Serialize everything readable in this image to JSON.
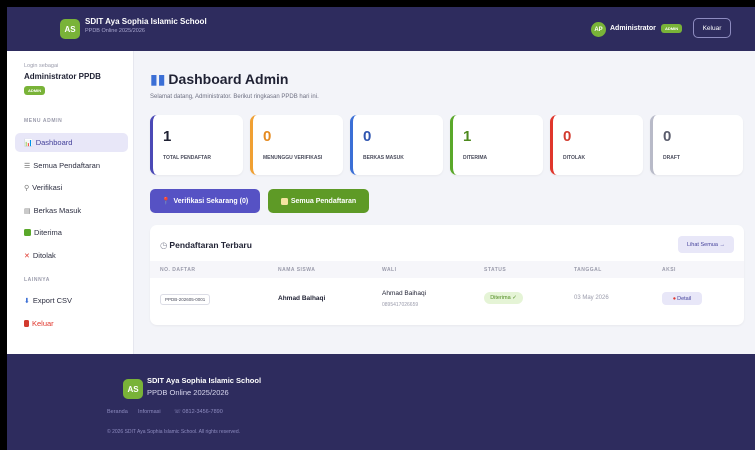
{
  "header": {
    "logo_initials": "AS",
    "school_name": "SDIT Aya Sophia Islamic School",
    "subtitle": "PPDB Online 2025/2026",
    "avatar_initials": "AP",
    "user_name": "Administrator",
    "role_badge": "ADMIN",
    "logout_label": "Keluar"
  },
  "sidebar": {
    "login_as": "Login sebagai",
    "user_name": "Administrator PPDB",
    "role_badge": "ADMIN",
    "menu_section": "MENU ADMIN",
    "items": [
      {
        "label": "Dashboard",
        "icon": "chart-icon"
      },
      {
        "label": "Semua Pendaftaran",
        "icon": "list-icon"
      },
      {
        "label": "Verifikasi",
        "icon": "search-icon"
      },
      {
        "label": "Berkas Masuk",
        "icon": "file-icon"
      },
      {
        "label": "Diterima",
        "icon": "check-icon"
      },
      {
        "label": "Ditolak",
        "icon": "x-icon"
      }
    ],
    "other_section": "LAINNYA",
    "other_items": [
      {
        "label": "Export CSV",
        "icon": "download-icon"
      },
      {
        "label": "Keluar",
        "icon": "logout-icon"
      }
    ]
  },
  "main": {
    "title": "Dashboard Admin",
    "subtitle": "Selamat datang, Administrator. Berikut ringkasan PPDB hari ini.",
    "stats": [
      {
        "value": "1",
        "label": "TOTAL PENDAFTAR",
        "color": "#4b49b6"
      },
      {
        "value": "0",
        "label": "MENUNGGU VERIFIKASI",
        "color": "#f0a033"
      },
      {
        "value": "0",
        "label": "BERKAS MASUK",
        "color": "#3b6fd6"
      },
      {
        "value": "1",
        "label": "DITERIMA",
        "color": "#5aa82a"
      },
      {
        "value": "0",
        "label": "DITOLAK",
        "color": "#e0362c"
      },
      {
        "value": "0",
        "label": "DRAFT",
        "color": "#b8bac8"
      }
    ],
    "verify_button": "Verifikasi Sekarang (0)",
    "all_button": "Semua Pendaftaran"
  },
  "recent": {
    "title": "Pendaftaran Terbaru",
    "view_all": "Lihat Semua →",
    "columns": [
      "NO. DAFTAR",
      "NAMA SISWA",
      "WALI",
      "STATUS",
      "TANGGAL",
      "AKSI"
    ],
    "rows": [
      {
        "no_daftar": "PPDB-202605-0001",
        "nama": "Ahmad Balhaqi",
        "wali": "Ahmad Baihaqi",
        "wali_phone": "0895417026659",
        "status": "Diterima ✓",
        "tanggal": "03 May 2026",
        "aksi": "Detail"
      }
    ]
  },
  "footer": {
    "logo_initials": "AS",
    "school_name": "SDIT Aya Sophia Islamic School",
    "subtitle": "PPDB Online 2025/2026",
    "links": [
      "Beranda",
      "Informasi",
      "☏ 0812-3456-7890"
    ],
    "copyright": "© 2026 SDIT Aya Sophia Islamic School. All rights reserved."
  }
}
